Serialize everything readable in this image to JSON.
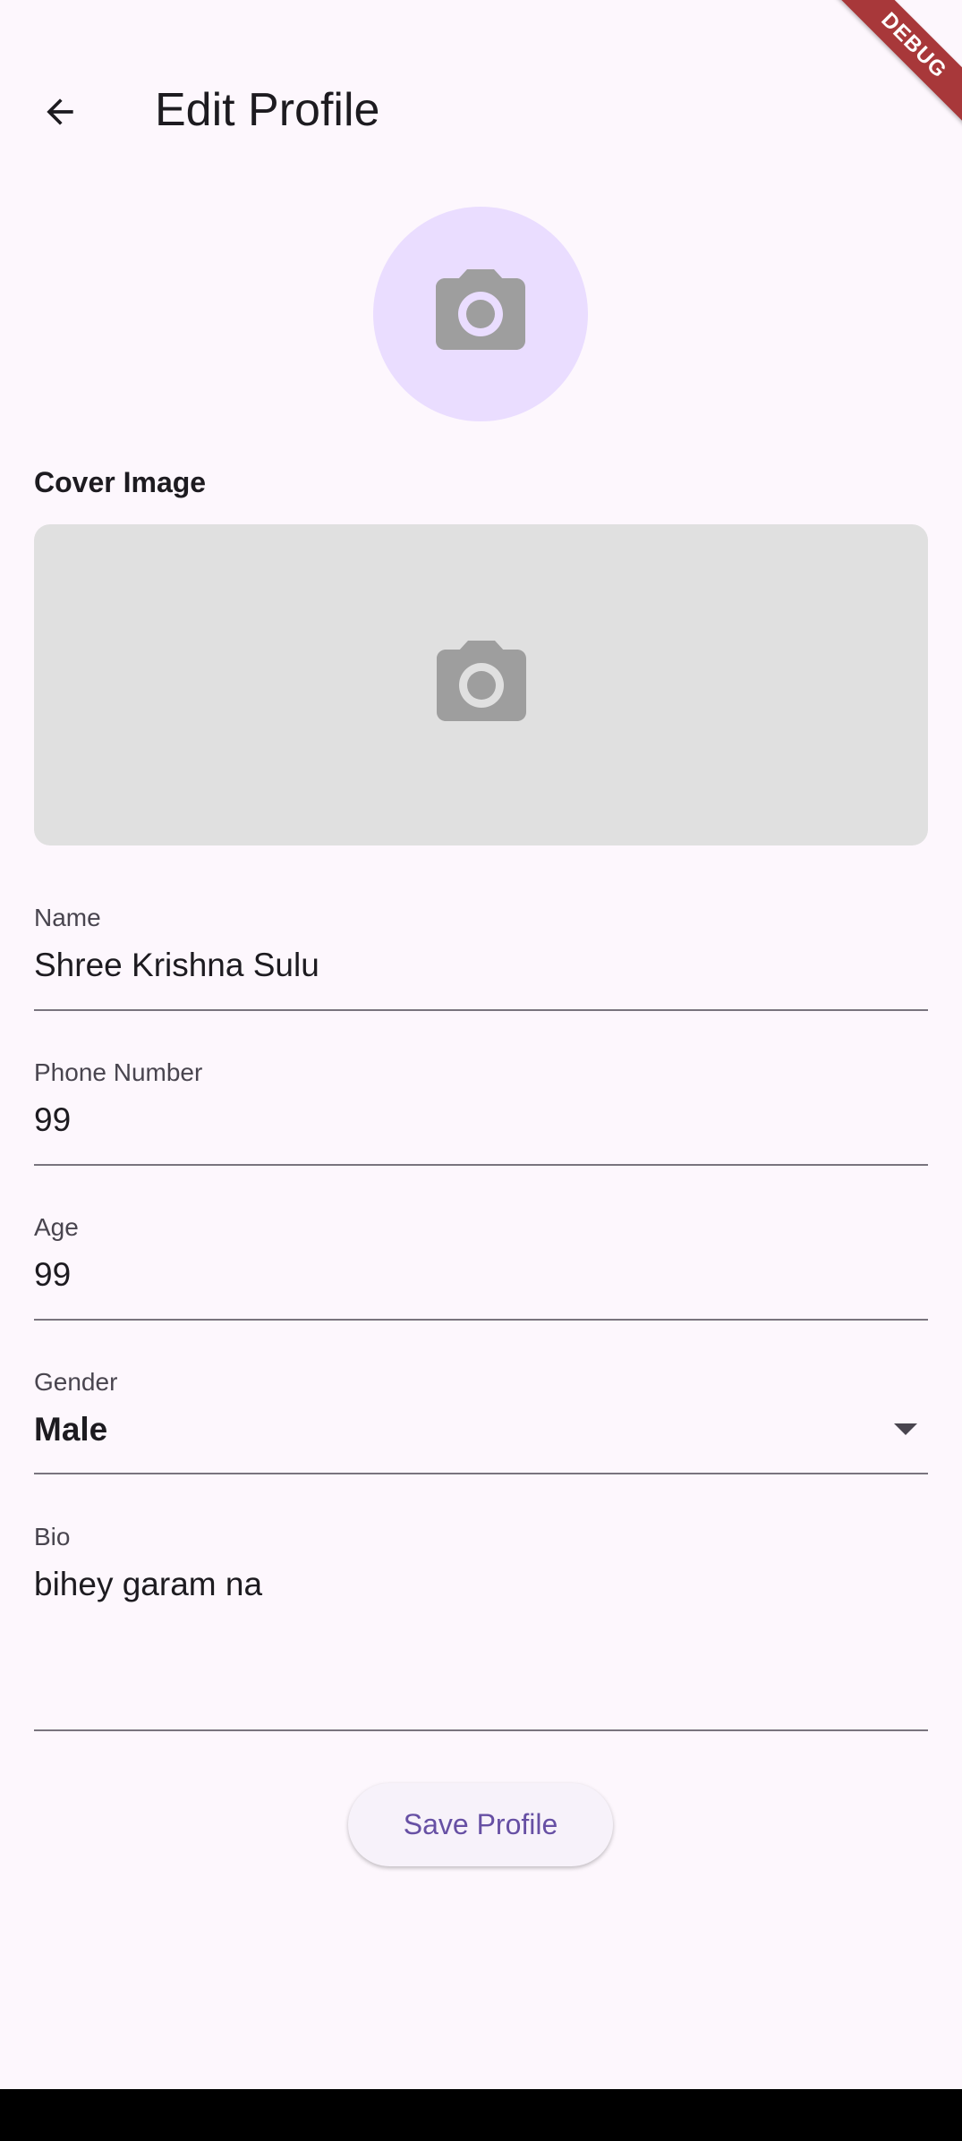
{
  "app_bar": {
    "title": "Edit Profile",
    "back_icon": "arrow-back-icon"
  },
  "debug_banner": {
    "label": "DEBUG"
  },
  "avatar": {
    "icon": "camera-icon"
  },
  "cover": {
    "label": "Cover Image",
    "icon": "camera-icon"
  },
  "form": {
    "name": {
      "label": "Name",
      "value": "Shree Krishna Sulu"
    },
    "phone": {
      "label": "Phone Number",
      "value": "99"
    },
    "age": {
      "label": "Age",
      "value": "99"
    },
    "gender": {
      "label": "Gender",
      "value": "Male",
      "icon": "dropdown-arrow-icon"
    },
    "bio": {
      "label": "Bio",
      "value": "bihey garam na"
    }
  },
  "actions": {
    "save_label": "Save Profile"
  },
  "colors": {
    "background": "#fdf7fd",
    "avatar_bg": "#eaddff",
    "cover_bg": "#e0e0e0",
    "icon_gray": "#9e9e9e",
    "primary": "#6750a4",
    "debug_banner": "#a8383a"
  }
}
